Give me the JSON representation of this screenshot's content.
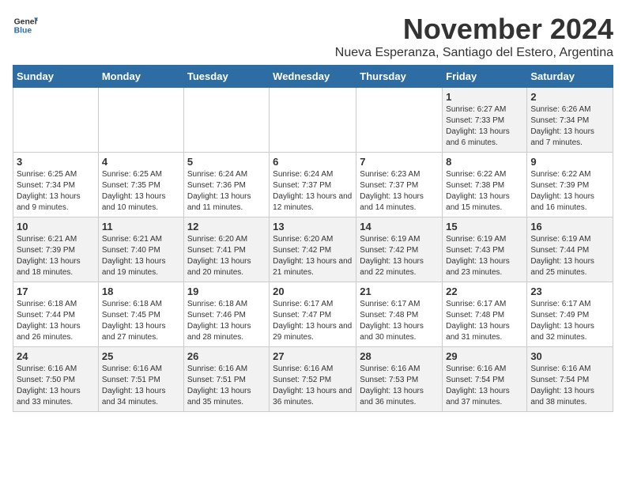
{
  "header": {
    "logo_general": "General",
    "logo_blue": "Blue",
    "month_title": "November 2024",
    "location": "Nueva Esperanza, Santiago del Estero, Argentina"
  },
  "days_of_week": [
    "Sunday",
    "Monday",
    "Tuesday",
    "Wednesday",
    "Thursday",
    "Friday",
    "Saturday"
  ],
  "weeks": [
    [
      {
        "day": "",
        "info": ""
      },
      {
        "day": "",
        "info": ""
      },
      {
        "day": "",
        "info": ""
      },
      {
        "day": "",
        "info": ""
      },
      {
        "day": "",
        "info": ""
      },
      {
        "day": "1",
        "info": "Sunrise: 6:27 AM\nSunset: 7:33 PM\nDaylight: 13 hours and 6 minutes."
      },
      {
        "day": "2",
        "info": "Sunrise: 6:26 AM\nSunset: 7:34 PM\nDaylight: 13 hours and 7 minutes."
      }
    ],
    [
      {
        "day": "3",
        "info": "Sunrise: 6:25 AM\nSunset: 7:34 PM\nDaylight: 13 hours and 9 minutes."
      },
      {
        "day": "4",
        "info": "Sunrise: 6:25 AM\nSunset: 7:35 PM\nDaylight: 13 hours and 10 minutes."
      },
      {
        "day": "5",
        "info": "Sunrise: 6:24 AM\nSunset: 7:36 PM\nDaylight: 13 hours and 11 minutes."
      },
      {
        "day": "6",
        "info": "Sunrise: 6:24 AM\nSunset: 7:37 PM\nDaylight: 13 hours and 12 minutes."
      },
      {
        "day": "7",
        "info": "Sunrise: 6:23 AM\nSunset: 7:37 PM\nDaylight: 13 hours and 14 minutes."
      },
      {
        "day": "8",
        "info": "Sunrise: 6:22 AM\nSunset: 7:38 PM\nDaylight: 13 hours and 15 minutes."
      },
      {
        "day": "9",
        "info": "Sunrise: 6:22 AM\nSunset: 7:39 PM\nDaylight: 13 hours and 16 minutes."
      }
    ],
    [
      {
        "day": "10",
        "info": "Sunrise: 6:21 AM\nSunset: 7:39 PM\nDaylight: 13 hours and 18 minutes."
      },
      {
        "day": "11",
        "info": "Sunrise: 6:21 AM\nSunset: 7:40 PM\nDaylight: 13 hours and 19 minutes."
      },
      {
        "day": "12",
        "info": "Sunrise: 6:20 AM\nSunset: 7:41 PM\nDaylight: 13 hours and 20 minutes."
      },
      {
        "day": "13",
        "info": "Sunrise: 6:20 AM\nSunset: 7:42 PM\nDaylight: 13 hours and 21 minutes."
      },
      {
        "day": "14",
        "info": "Sunrise: 6:19 AM\nSunset: 7:42 PM\nDaylight: 13 hours and 22 minutes."
      },
      {
        "day": "15",
        "info": "Sunrise: 6:19 AM\nSunset: 7:43 PM\nDaylight: 13 hours and 23 minutes."
      },
      {
        "day": "16",
        "info": "Sunrise: 6:19 AM\nSunset: 7:44 PM\nDaylight: 13 hours and 25 minutes."
      }
    ],
    [
      {
        "day": "17",
        "info": "Sunrise: 6:18 AM\nSunset: 7:44 PM\nDaylight: 13 hours and 26 minutes."
      },
      {
        "day": "18",
        "info": "Sunrise: 6:18 AM\nSunset: 7:45 PM\nDaylight: 13 hours and 27 minutes."
      },
      {
        "day": "19",
        "info": "Sunrise: 6:18 AM\nSunset: 7:46 PM\nDaylight: 13 hours and 28 minutes."
      },
      {
        "day": "20",
        "info": "Sunrise: 6:17 AM\nSunset: 7:47 PM\nDaylight: 13 hours and 29 minutes."
      },
      {
        "day": "21",
        "info": "Sunrise: 6:17 AM\nSunset: 7:48 PM\nDaylight: 13 hours and 30 minutes."
      },
      {
        "day": "22",
        "info": "Sunrise: 6:17 AM\nSunset: 7:48 PM\nDaylight: 13 hours and 31 minutes."
      },
      {
        "day": "23",
        "info": "Sunrise: 6:17 AM\nSunset: 7:49 PM\nDaylight: 13 hours and 32 minutes."
      }
    ],
    [
      {
        "day": "24",
        "info": "Sunrise: 6:16 AM\nSunset: 7:50 PM\nDaylight: 13 hours and 33 minutes."
      },
      {
        "day": "25",
        "info": "Sunrise: 6:16 AM\nSunset: 7:51 PM\nDaylight: 13 hours and 34 minutes."
      },
      {
        "day": "26",
        "info": "Sunrise: 6:16 AM\nSunset: 7:51 PM\nDaylight: 13 hours and 35 minutes."
      },
      {
        "day": "27",
        "info": "Sunrise: 6:16 AM\nSunset: 7:52 PM\nDaylight: 13 hours and 36 minutes."
      },
      {
        "day": "28",
        "info": "Sunrise: 6:16 AM\nSunset: 7:53 PM\nDaylight: 13 hours and 36 minutes."
      },
      {
        "day": "29",
        "info": "Sunrise: 6:16 AM\nSunset: 7:54 PM\nDaylight: 13 hours and 37 minutes."
      },
      {
        "day": "30",
        "info": "Sunrise: 6:16 AM\nSunset: 7:54 PM\nDaylight: 13 hours and 38 minutes."
      }
    ]
  ]
}
